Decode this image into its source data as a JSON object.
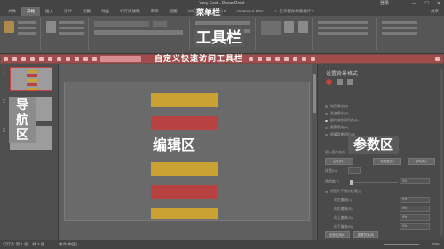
{
  "titlebar": {
    "title": "Very Fast - PowerPoint",
    "user": "登录",
    "controls": [
      "—",
      "☐",
      "✕"
    ]
  },
  "menubar": {
    "tabs": [
      "文件",
      "开始",
      "插入",
      "设计",
      "切换",
      "动画",
      "幻灯片放映",
      "审阅",
      "视图",
      "iSlide",
      "OneKey 8",
      "OneKey 8 Plus"
    ],
    "active_index": 1,
    "tell_me": "告诉我你想要做什么",
    "share": "共享"
  },
  "annotations": {
    "menu_bar": "菜单栏",
    "ribbon": "工具栏",
    "quick_access": "自定义快速访问工具栏",
    "nav": [
      "导",
      "航",
      "区"
    ],
    "edit": "编辑区",
    "params": "参数区"
  },
  "left_pane": {
    "slide_numbers": [
      "1",
      "2",
      "3"
    ]
  },
  "right_pane": {
    "title": "设置背景格式",
    "options": [
      {
        "label": "纯色填充(S)",
        "on": false
      },
      {
        "label": "渐变填充(G)",
        "on": false
      },
      {
        "label": "图片或纹理填充(P)",
        "on": true
      },
      {
        "label": "图案填充(A)",
        "on": false
      },
      {
        "label": "隐藏背景图形(H)",
        "on": false
      }
    ],
    "insert_label": "插入图片来自",
    "buttons": [
      "文件(F)...",
      "剪贴板(C)",
      "联机(E)..."
    ],
    "texture_label": "纹理(U)",
    "transparency_label": "透明度(T)",
    "transparency_value": "0%",
    "tile_label": "将图片平铺为纹理(I)",
    "offsets": [
      {
        "label": "向左偏移(L)",
        "value": "0%"
      },
      {
        "label": "向右偏移(R)",
        "value": "0%"
      },
      {
        "label": "向上偏移(O)",
        "value": "0%"
      },
      {
        "label": "向下偏移(M)",
        "value": "0%"
      }
    ],
    "footer_buttons": [
      "全部应用(L)",
      "重置背景(B)"
    ]
  },
  "statusbar": {
    "slide_info": "幻灯片 第 1 张，共 3 张",
    "language": "中文(中国)",
    "zoom": "60%"
  }
}
